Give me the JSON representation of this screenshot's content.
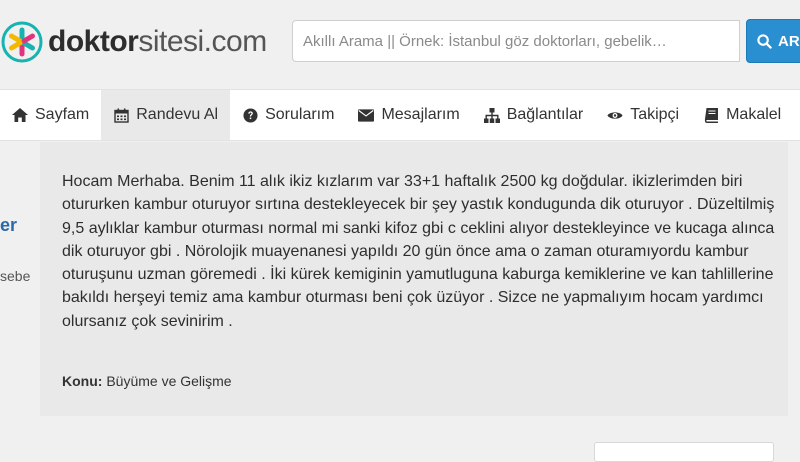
{
  "brand": {
    "name_bold": "doktor",
    "name_light": "sitesi.com"
  },
  "search": {
    "placeholder": "Akıllı Arama || Örnek: İstanbul göz doktorları, gebelik…",
    "button_label": "AR"
  },
  "nav": {
    "items": [
      {
        "label": "Sayfam",
        "icon": "home-icon"
      },
      {
        "label": "Randevu Al",
        "icon": "calendar-icon"
      },
      {
        "label": "Sorularım",
        "icon": "question-circle-icon"
      },
      {
        "label": "Mesajlarım",
        "icon": "envelope-icon"
      },
      {
        "label": "Bağlantılar",
        "icon": "sitemap-icon"
      },
      {
        "label": "Takipçi",
        "icon": "eye-icon"
      },
      {
        "label": "Makalel",
        "icon": "book-icon"
      }
    ]
  },
  "sidebar": {
    "fragment_name": "er",
    "fragment_text": "sebe"
  },
  "question": {
    "text": "Hocam Merhaba. Benim 11 alık ikiz kızlarım var 33+1 haftalık 2500 kg doğdular. ikizlerimden biri otururken kambur oturuyor sırtına destekleyecek bir şey yastık kondugunda dik oturuyor . Düzeltilmiş 9,5 aylıklar kambur oturması normal mi sanki kifoz gbi c ceklini alıyor destekleyince ve kucaga alınca dik oturuyor gbi . Nörolojik muayenanesi yapıldı 20 gün önce ama o zaman oturamıyordu kambur oturuşunu uzman göremedi . İki kürek kemiginin yamutluguna kaburga kemiklerine ve kan tahlillerine bakıldı herşeyi temiz ama kambur oturması beni çok üzüyor . Sizce ne yapmalıyım hocam yardımcı olursanız çok sevinirim .",
    "topic_key": "Konu:",
    "topic_value": "Büyüme ve Gelişme"
  },
  "colors": {
    "accent": "#2a8fd1",
    "logo_teal": "#16b3b0",
    "logo_pink": "#e0357a",
    "logo_yellow": "#f3b800"
  }
}
